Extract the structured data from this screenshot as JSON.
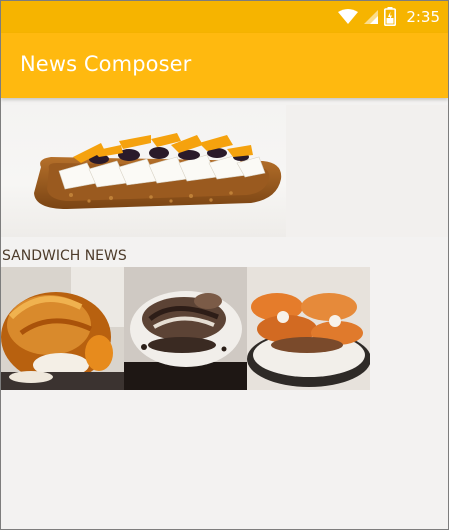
{
  "status": {
    "time": "2:35",
    "icons": [
      "wifi-icon",
      "signal-icon",
      "battery-icon"
    ]
  },
  "appbar": {
    "title": "News Composer",
    "color": "#ffb90f"
  },
  "hero": {
    "image": "open-sandwich-photo"
  },
  "section": {
    "title": "SANDWICH NEWS"
  },
  "thumbnails": [
    {
      "image": "roast-sandwich-photo"
    },
    {
      "image": "mushroom-toast-photo"
    },
    {
      "image": "salmon-toast-photo"
    }
  ]
}
